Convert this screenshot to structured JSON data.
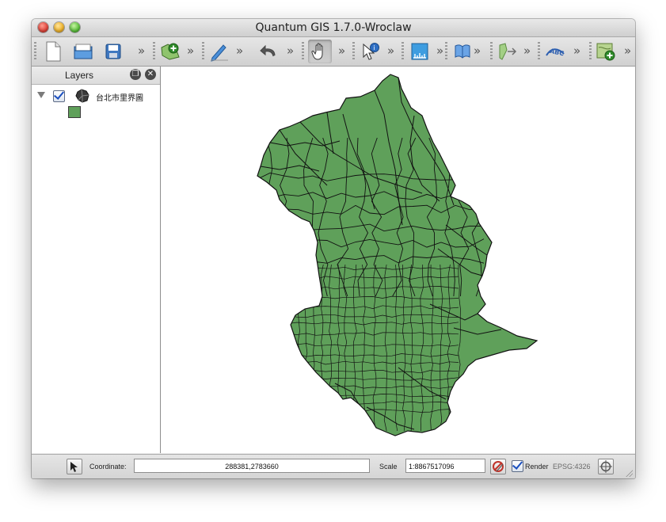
{
  "window": {
    "title": "Quantum GIS 1.7.0-Wroclaw"
  },
  "toolbar": {
    "chevron": "»",
    "buttons": [
      {
        "name": "new-project-icon"
      },
      {
        "name": "open-project-icon"
      },
      {
        "name": "save-project-icon"
      },
      {
        "name": "add-vector-layer-icon"
      },
      {
        "name": "toggle-editing-icon"
      },
      {
        "name": "undo-icon"
      },
      {
        "name": "pan-hand-icon",
        "active": true
      },
      {
        "name": "identify-icon"
      },
      {
        "name": "measure-icon"
      },
      {
        "name": "help-icon"
      },
      {
        "name": "plugin-icon"
      },
      {
        "name": "label-icon"
      },
      {
        "name": "add-layer-icon"
      }
    ]
  },
  "layers_panel": {
    "title": "Layers",
    "layers": [
      {
        "name": "台北市里界圖",
        "visible": true,
        "fill_color": "#5fa05a"
      }
    ]
  },
  "map": {
    "fill_color": "#5fa05a",
    "stroke_color": "#111111"
  },
  "statusbar": {
    "coordinate_label": "Coordinate:",
    "coordinate_value": "288381,2783660",
    "scale_label": "Scale",
    "scale_value": "1:8867517096",
    "render_label": "Render",
    "render_checked": true,
    "crs": "EPSG:4326"
  }
}
